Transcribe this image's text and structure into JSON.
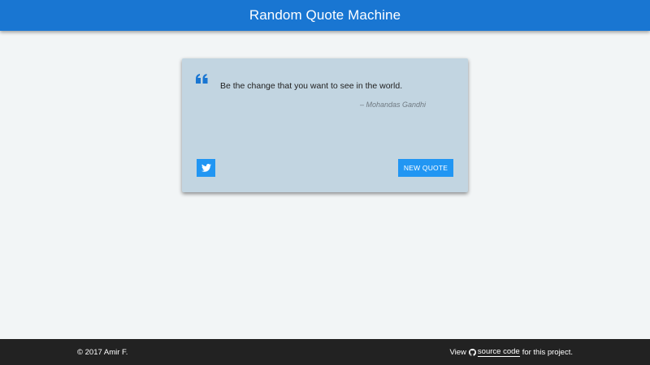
{
  "header": {
    "title": "Random Quote Machine"
  },
  "quote": {
    "text": "Be the change that you want to see in the world.",
    "author": "– Mohandas Gandhi"
  },
  "actions": {
    "tweet_icon": "twitter-icon",
    "new_quote_label": "NEW QUOTE"
  },
  "footer": {
    "copyright": "© 2017 Amir F.",
    "view_prefix": "View",
    "source_link": "source code",
    "view_suffix": "for this project.",
    "github_icon": "github-icon"
  },
  "colors": {
    "header_bg": "#1976d2",
    "card_bg": "#c2d5e1",
    "button_bg": "#2196f3",
    "footer_bg": "#222222",
    "page_bg": "#f2f5f6"
  }
}
